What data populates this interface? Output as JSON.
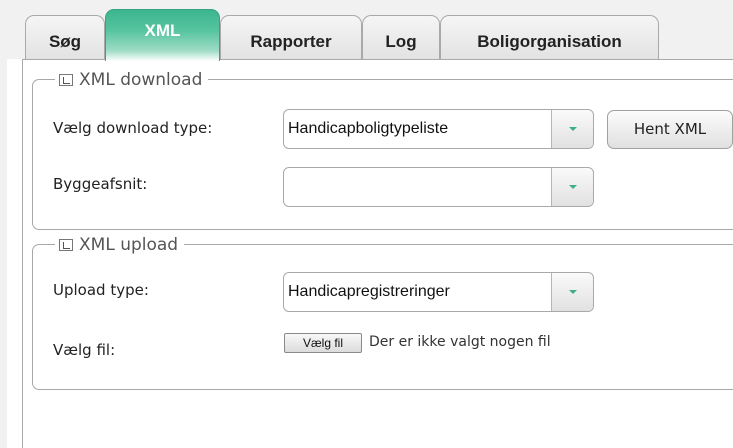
{
  "tabs": [
    {
      "label": "Søg"
    },
    {
      "label": "XML"
    },
    {
      "label": "Rapporter"
    },
    {
      "label": "Log"
    },
    {
      "label": "Boligorganisation"
    }
  ],
  "download": {
    "legend": "XML download",
    "type_label": "Vælg download type:",
    "type_value": "Handicapboligtypeliste",
    "fetch_button": "Hent XML",
    "section_label": "Byggeafsnit:",
    "section_value": ""
  },
  "upload": {
    "legend": "XML upload",
    "type_label": "Upload type:",
    "type_value": "Handicapregistreringer",
    "file_label": "Vælg fil:",
    "file_button": "Vælg fil",
    "file_status": "Der er ikke valgt nogen fil"
  },
  "colors": {
    "accent": "#3cb58f",
    "border": "#a9a9a9"
  }
}
